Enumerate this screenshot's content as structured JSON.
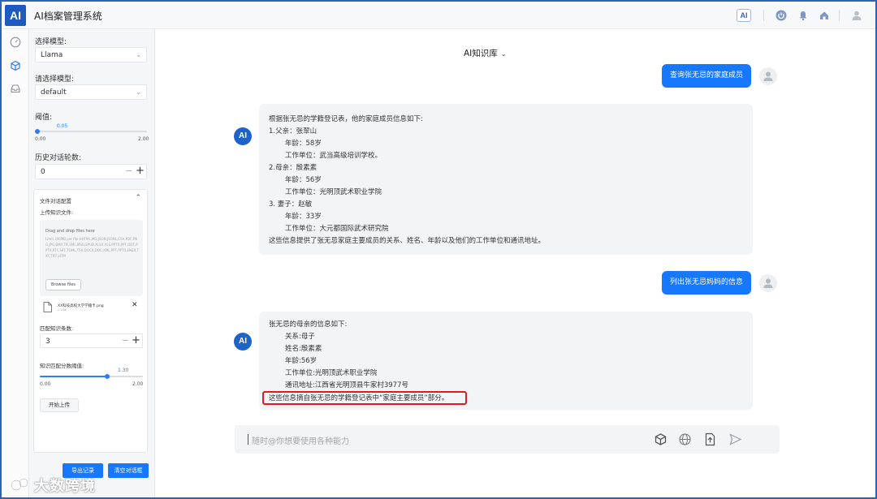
{
  "header": {
    "logo": "AI",
    "title": "AI档案管理系统",
    "ai_badge": "AI",
    "icons": [
      "power-icon",
      "bell-icon",
      "home-icon",
      "user-icon"
    ]
  },
  "rail": {
    "icons": [
      "dashboard-icon",
      "cube-icon",
      "inbox-icon"
    ]
  },
  "sidebar": {
    "model_label": "选择模型:",
    "model_value": "Llama",
    "model2_label": "请选择模型:",
    "model2_value": "default",
    "threshold_label": "阈值:",
    "threshold_value": "0.05",
    "threshold_fraction": 0.025,
    "threshold_min": "0.00",
    "threshold_max": "2.00",
    "history_label": "历史对话轮数:",
    "history_value": "0",
    "file_config": {
      "title": "文件对话配置",
      "upload_label": "上传知识文件:",
      "drop_title": "Drag and drop files here",
      "drop_types": "Limit 200MB per file·HHTML,MD,JSON,JSONL,CSV,PDF,PNG,JPG,BMP,TIF,EML,MSG,EPUB,XLSX,XLS,PPTX,PPT,ODT,PPTX,RTF,SRT,TOML,TSV,DOCX,DOC,XML,PPT,PPTX,ENEX,TXT,TIFF,HTM",
      "browse_label": "Browse files",
      "file_name": "XX科技高校大学学籍卡.png",
      "file_size": "0.1MB",
      "match_label": "匹配知识条数:",
      "match_value": "3",
      "score_label": "知识匹配分数阈值:",
      "score_value": "1.30",
      "score_fraction": 0.65,
      "score_min": "0.00",
      "score_max": "2.00",
      "start_label": "开始上传"
    },
    "export_label": "导出记录",
    "clear_label": "清空对话框"
  },
  "chat": {
    "kb_title": "AI知识库",
    "ai_avatar": "AI",
    "messages": [
      {
        "role": "user",
        "text": "查询张无忌的家庭成员"
      },
      {
        "role": "ai",
        "lines": [
          "根据张无忌的学籍登记表，他的家庭成员信息如下:",
          "1.父亲：张翠山",
          "年龄：58岁",
          "工作单位：武当高级培训学校。",
          "2.母亲：殷素素",
          "年龄：56岁",
          "工作单位：光明顶武术职业学院",
          "3. 妻子：赵敏",
          "年龄：33岁",
          "工作单位：大元都国际武术研究院",
          "这些信息提供了张无忌家庭主要成员的关系、姓名、年龄以及他们的工作单位和通讯地址。"
        ]
      },
      {
        "role": "user",
        "text": "列出张无忌妈妈的信息"
      },
      {
        "role": "ai",
        "lines": [
          "张无忌的母亲的信息如下:",
          "关系:母子",
          "姓名:殷素素",
          "年龄:56岁",
          "工作单位:光明顶武术职业学院",
          "通讯地址:江西省光明顶县牛家村3977号",
          "这些信息摘自张无忌的学籍登记表中“家庭主要成员”部分。"
        ]
      }
    ],
    "input_placeholder": "随时@你想要使用各种能力",
    "input_icons": [
      "cube-icon",
      "globe-icon",
      "file-upload-icon",
      "send-icon"
    ]
  },
  "watermark": "大数跨境"
}
